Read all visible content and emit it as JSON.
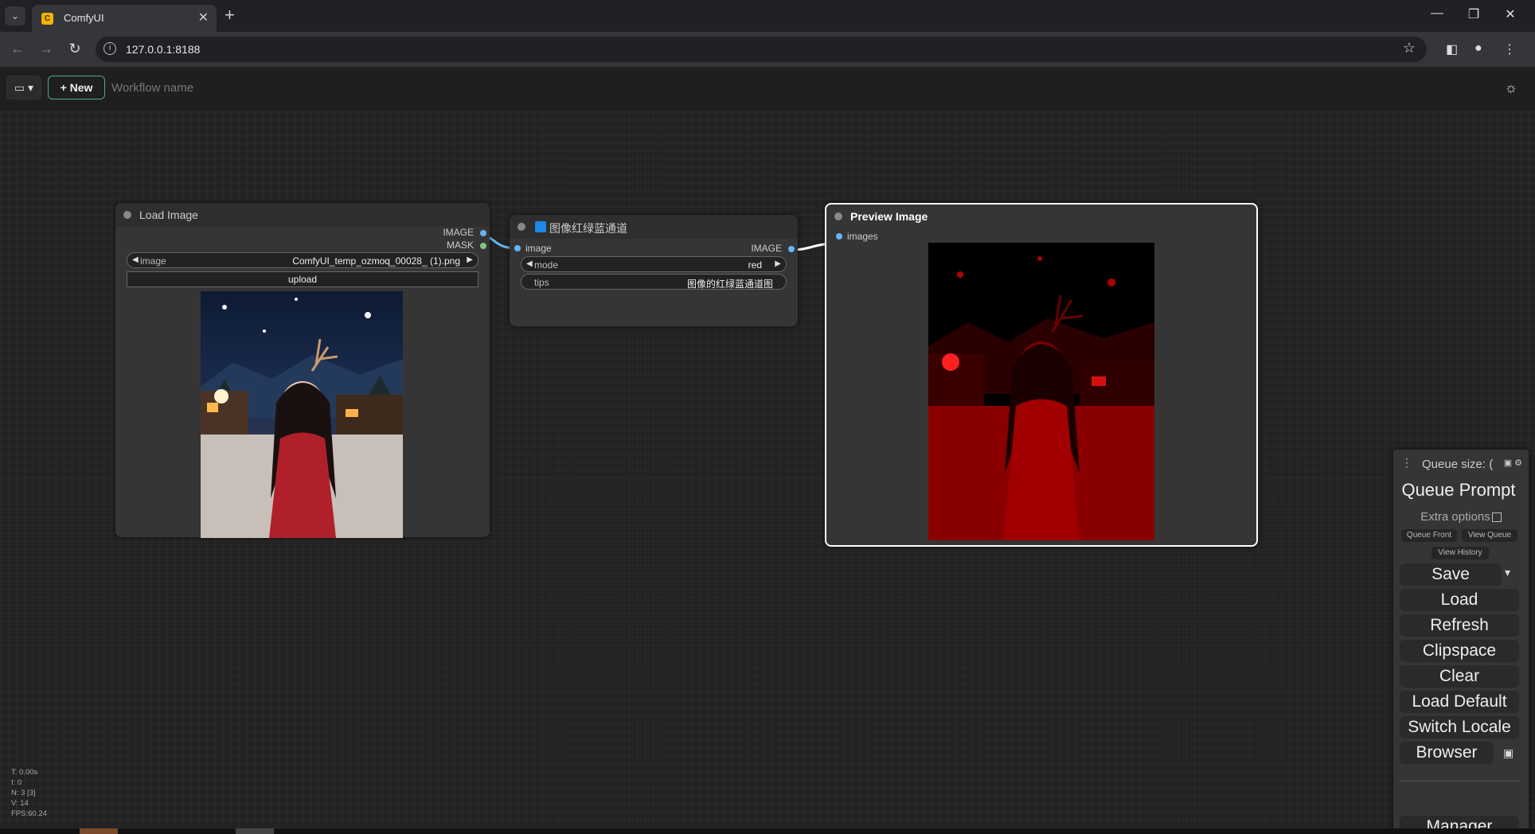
{
  "browser": {
    "tab_title": "ComfyUI",
    "tab_favicon": "C",
    "url": "127.0.0.1:8188",
    "close_glyph": "✕",
    "newtab_glyph": "+",
    "min_glyph": "—",
    "restore_glyph": "❐",
    "winclose_glyph": "✕",
    "back_glyph": "←",
    "forward_glyph": "→",
    "reload_glyph": "↻",
    "star_glyph": "☆",
    "menu_glyph": "⋮"
  },
  "comfy": {
    "workflow_button": "▭ ▾",
    "new_label": "+ New",
    "workflow_placeholder": "Workflow name",
    "theme_icon": "☼"
  },
  "nodes": {
    "load_image": {
      "title": "Load Image",
      "out_image": "IMAGE",
      "out_mask": "MASK",
      "widget_label": "image",
      "widget_value": "ComfyUI_temp_ozmoq_00028_ (1).png",
      "upload_label": "upload"
    },
    "channel": {
      "title": "图像红绿蓝通道",
      "in_image": "image",
      "out_image": "IMAGE",
      "mode_label": "mode",
      "mode_value": "red",
      "tips_label": "tips",
      "tips_value": "图像的红绿蓝通道图"
    },
    "preview": {
      "title": "Preview Image",
      "in_images": "images"
    }
  },
  "sidemenu": {
    "queue_size": "Queue size: (",
    "queue_prompt": "Queue Prompt",
    "extra_options": "Extra options",
    "queue_front": "Queue Front",
    "view_queue": "View Queue",
    "view_history": "View History",
    "save": "Save",
    "load": "Load",
    "refresh": "Refresh",
    "clipspace": "Clipspace",
    "clear": "Clear",
    "load_default": "Load Default",
    "switch_locale": "Switch Locale",
    "browser": "Browser",
    "manager": "Manager"
  },
  "stats": {
    "t": "T: 0.00s",
    "i": "I: 0",
    "n": "N: 3 [3]",
    "v": "V: 14",
    "fps": "FPS:60.24"
  },
  "colors": {
    "image_link": "#64b5f6",
    "mask_link": "#81c784",
    "new_border": "#4caf80",
    "preview_border": "#ffffff"
  }
}
